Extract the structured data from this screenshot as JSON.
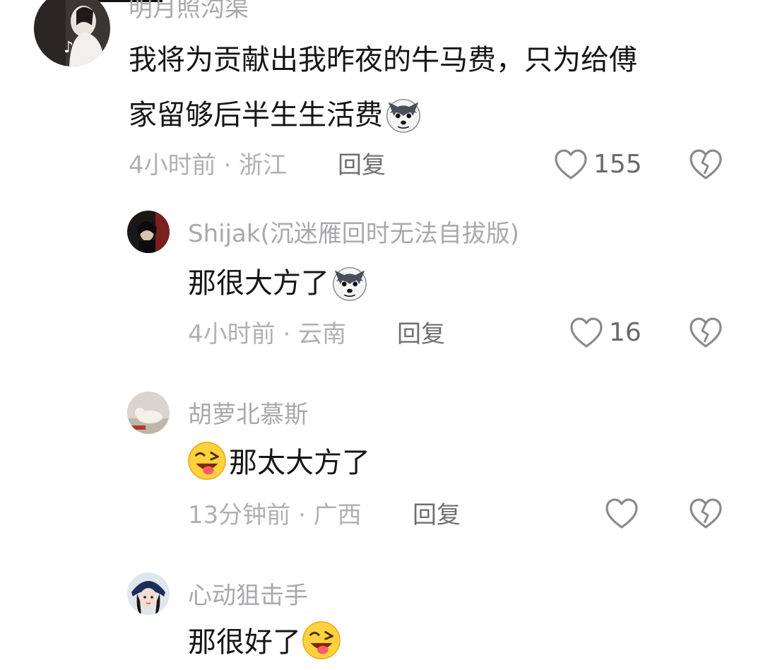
{
  "comments": [
    {
      "username": "明月照沟渠",
      "text_line1": "我将为贡献出我昨夜的牛马费，只为给傅",
      "text_line2": "家留够后半生生活费",
      "emoji": "husky-dog-emoji",
      "time_location": "4小时前 · 浙江",
      "reply_label": "回复",
      "like_count": "155"
    },
    {
      "username": "Shijak(沉迷雁回时无法自拔版)",
      "text": "那很大方了",
      "emoji": "husky-dog-emoji",
      "time_location": "4小时前 · 云南",
      "reply_label": "回复",
      "like_count": "16"
    },
    {
      "username": "胡萝北慕斯",
      "emoji": "wink-tongue-emoji",
      "text": "那太大方了",
      "time_location": "13分钟前 · 广西",
      "reply_label": "回复",
      "like_count": ""
    },
    {
      "username": "心动狙击手",
      "text": "那很好了",
      "emoji": "wink-tongue-emoji"
    }
  ],
  "colors": {
    "username": "#a9a9ad",
    "text": "#161616",
    "meta": "#b0b0b4",
    "icon": "#8a8a8e"
  }
}
